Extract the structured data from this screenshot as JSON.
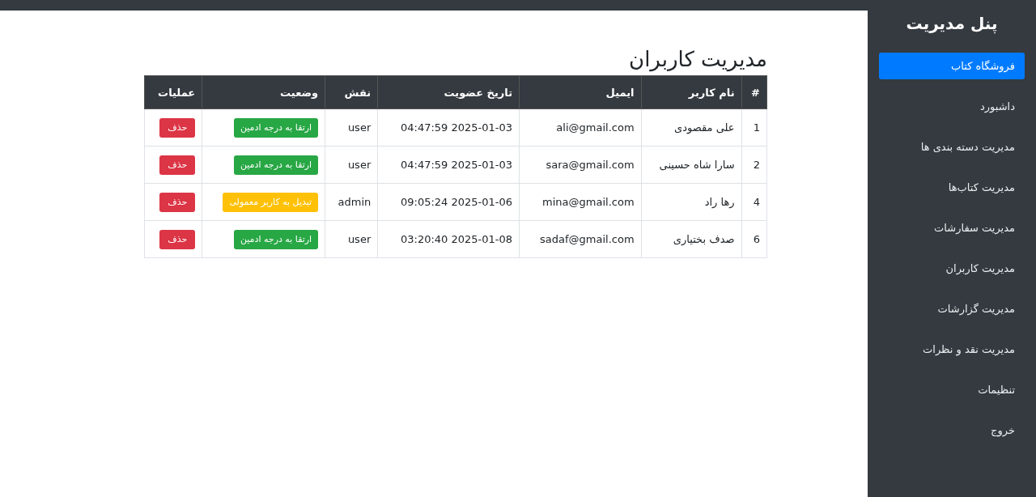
{
  "sidebar": {
    "title": "پنل مدیریت",
    "items": [
      {
        "label": "فروشگاه کتاب",
        "selected": true
      },
      {
        "label": "داشبورد",
        "selected": false
      },
      {
        "label": "مدیریت دسته بندی ها",
        "selected": false
      },
      {
        "label": "مدیریت کتاب‌ها",
        "selected": false
      },
      {
        "label": "مدیریت سفارشات",
        "selected": false
      },
      {
        "label": "مدیریت کاربران",
        "selected": false
      },
      {
        "label": "مدیریت گزارشات",
        "selected": false
      },
      {
        "label": "مدیریت نقد و نظرات",
        "selected": false
      },
      {
        "label": "تنظیمات",
        "selected": false
      },
      {
        "label": "خروج",
        "selected": false
      }
    ]
  },
  "page_title": "مدیریت کاربران",
  "table": {
    "columns": [
      "#",
      "نام کاربر",
      "ایمیل",
      "تاریخ عضویت",
      "نقش",
      "وضعیت",
      "عملیات"
    ],
    "rows": [
      {
        "id": "1",
        "name": "علی مقصودی",
        "email": "ali@gmail.com",
        "joined": "2025-01-03 04:47:59",
        "role": "user",
        "status": {
          "kind": "promote",
          "label": "ارتقا به درجه ادمین"
        },
        "delete": "حذف"
      },
      {
        "id": "2",
        "name": "سارا شاه حسینی",
        "email": "sara@gmail.com",
        "joined": "2025-01-03 04:47:59",
        "role": "user",
        "status": {
          "kind": "promote",
          "label": "ارتقا به درجه ادمین"
        },
        "delete": "حذف"
      },
      {
        "id": "4",
        "name": "رها راد",
        "email": "mina@gmail.com",
        "joined": "2025-01-06 09:05:24",
        "role": "admin",
        "status": {
          "kind": "demote",
          "label": "تبدیل به کاربر معمولی"
        },
        "delete": "حذف"
      },
      {
        "id": "6",
        "name": "صدف بختیاری",
        "email": "sadaf@gmail.com",
        "joined": "2025-01-08 03:20:40",
        "role": "user",
        "status": {
          "kind": "promote",
          "label": "ارتقا به درجه ادمین"
        },
        "delete": "حذف"
      }
    ]
  }
}
